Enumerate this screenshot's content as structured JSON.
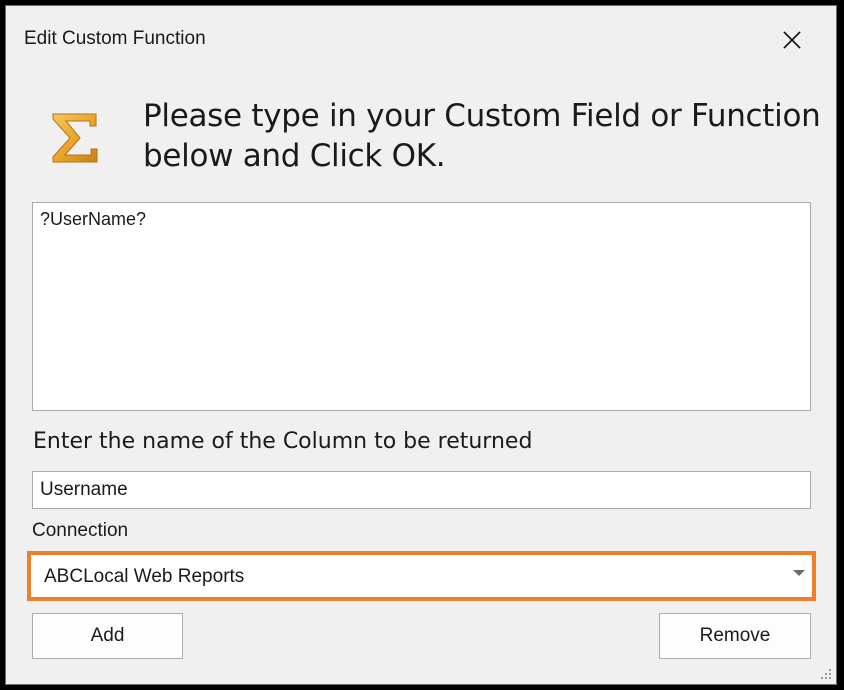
{
  "window": {
    "title": "Edit Custom Function"
  },
  "header": {
    "icon": "sigma-icon",
    "prompt_line1": "Please type in your Custom Field or Function",
    "prompt_line2": "below and Click OK."
  },
  "function_editor": {
    "value": "?UserName?"
  },
  "column": {
    "label": "Enter the name of the Column to be returned",
    "value": "Username"
  },
  "connection": {
    "label": "Connection",
    "selected": "ABCLocal Web Reports",
    "highlight_color": "#f07f2a"
  },
  "buttons": {
    "add_label": "Add",
    "remove_label": "Remove"
  },
  "colors": {
    "window_bg": "#f0f0f0",
    "sigma_gold": "#e8a326"
  }
}
